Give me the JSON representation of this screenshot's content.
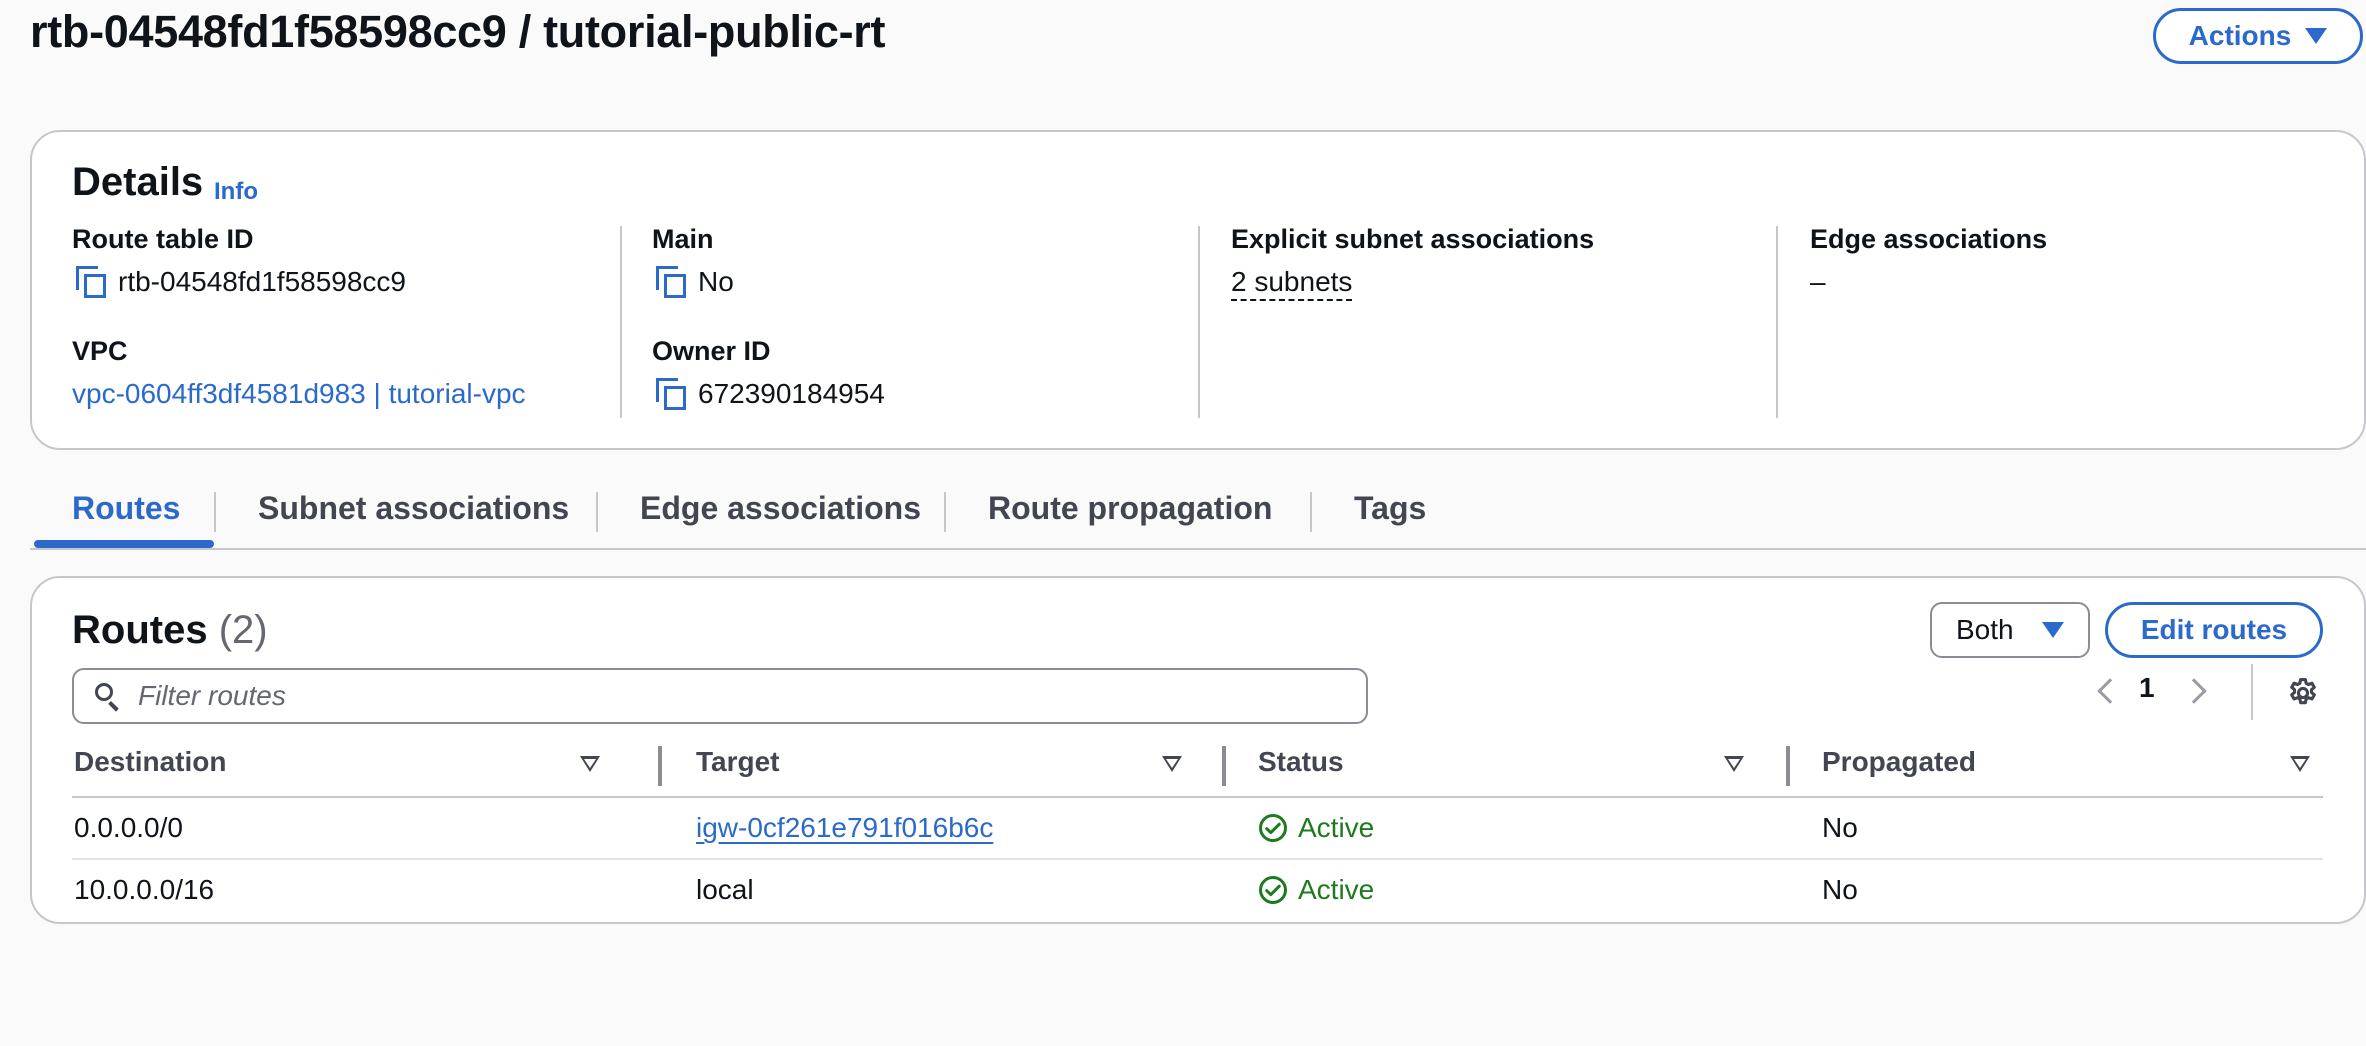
{
  "header": {
    "title": "rtb-04548fd1f58598cc9 / tutorial-public-rt",
    "actions_label": "Actions"
  },
  "details": {
    "heading": "Details",
    "info_label": "Info",
    "route_table_id_label": "Route table ID",
    "route_table_id": "rtb-04548fd1f58598cc9",
    "main_label": "Main",
    "main_value": "No",
    "explicit_subnet_label": "Explicit subnet associations",
    "explicit_subnet_value": "2 subnets",
    "edge_assoc_label": "Edge associations",
    "edge_assoc_value": "–",
    "vpc_label": "VPC",
    "vpc_value": "vpc-0604ff3df4581d983 | tutorial-vpc",
    "owner_id_label": "Owner ID",
    "owner_id": "672390184954"
  },
  "tabs": [
    {
      "label": "Routes",
      "active": true
    },
    {
      "label": "Subnet associations"
    },
    {
      "label": "Edge associations"
    },
    {
      "label": "Route propagation"
    },
    {
      "label": "Tags"
    }
  ],
  "routes": {
    "heading": "Routes",
    "count": "(2)",
    "filter_selected": "Both",
    "edit_label": "Edit routes",
    "search_placeholder": "Filter routes",
    "page_number": "1",
    "columns": [
      "Destination",
      "Target",
      "Status",
      "Propagated"
    ],
    "rows": [
      {
        "destination": "0.0.0.0/0",
        "target": "igw-0cf261e791f016b6c",
        "status": "Active",
        "propagated": "No"
      },
      {
        "destination": "10.0.0.0/16",
        "target": "local",
        "status": "Active",
        "propagated": "No"
      }
    ]
  },
  "colors": {
    "accent": "#2b6acb",
    "success": "#1f7a1f",
    "border": "#c6c6cd"
  },
  "icons": [
    "chevron-down-icon",
    "copy-icon",
    "search-icon",
    "chevron-left-icon",
    "chevron-right-icon",
    "gear-icon",
    "sort-icon",
    "check-circle-icon"
  ]
}
